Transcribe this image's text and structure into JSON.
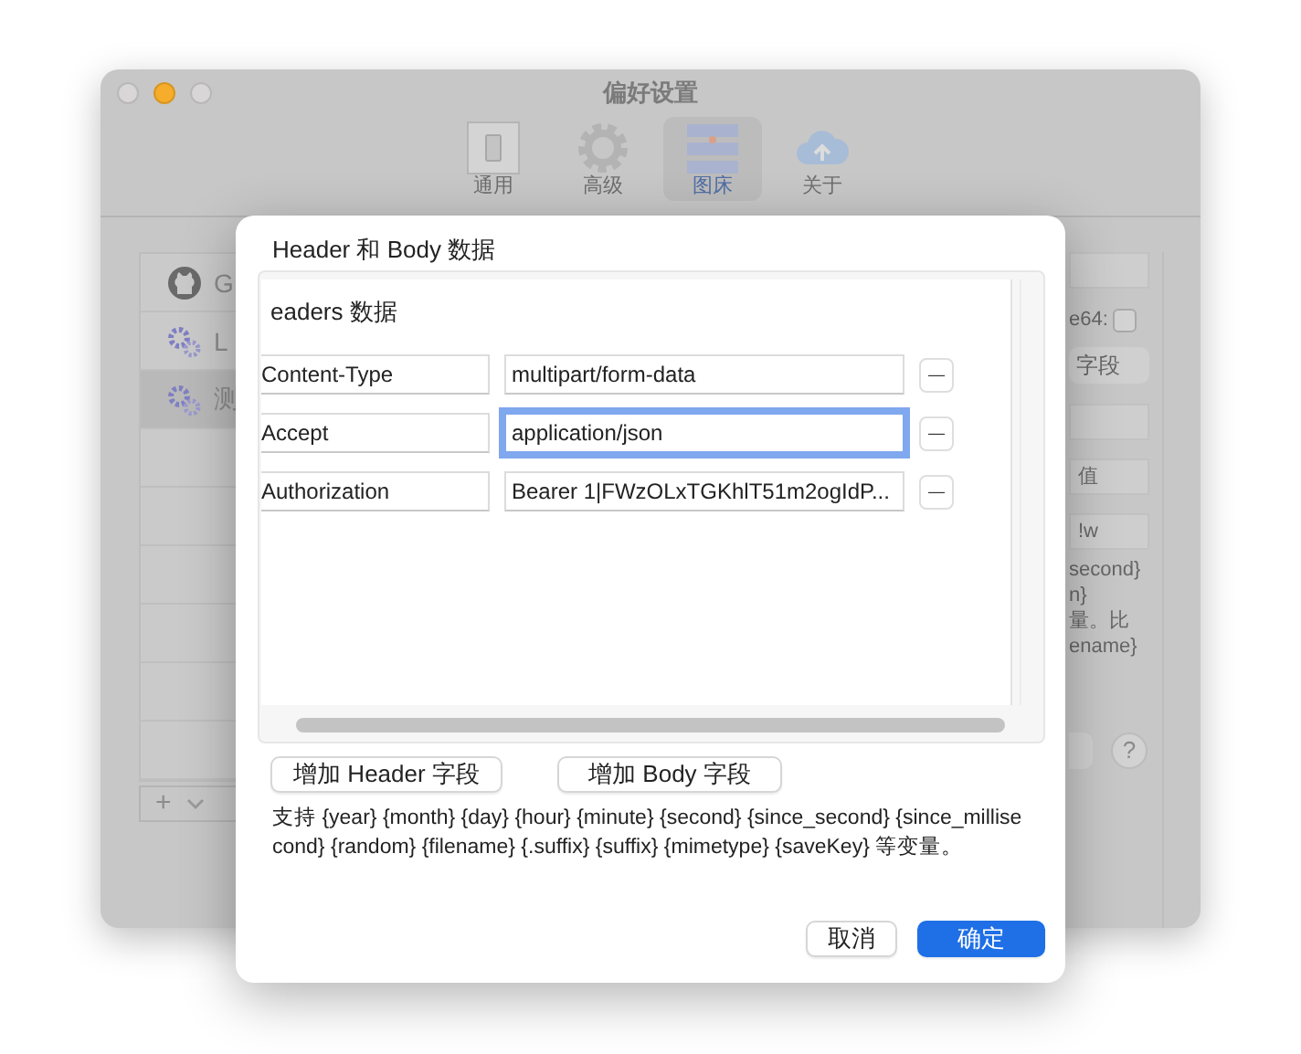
{
  "window": {
    "title": "偏好设置"
  },
  "toolbar": [
    {
      "label": "通用",
      "kind": "general",
      "selected": false
    },
    {
      "label": "高级",
      "kind": "advanced",
      "selected": false
    },
    {
      "label": "图床",
      "kind": "hosting",
      "selected": true
    },
    {
      "label": "关于",
      "kind": "about",
      "selected": false
    }
  ],
  "uploaders": [
    {
      "label": "G",
      "kind": "github",
      "selected": false
    },
    {
      "label": "L",
      "kind": "gears",
      "selected": false
    },
    {
      "label": "测",
      "kind": "gears",
      "selected": true
    }
  ],
  "list_controls": {
    "add": "+"
  },
  "settings_panel": {
    "checkbox_label": "e64:",
    "checked": false,
    "button": "字段",
    "placeholder": "值",
    "field_value": "!w",
    "text_lines": [
      "second}",
      "n}",
      "量。比",
      "ename}"
    ],
    "help": "?"
  },
  "dialog": {
    "title": "Header 和 Body 数据",
    "section": "eaders 数据",
    "headers": [
      {
        "key": "Content-Type",
        "value": "multipart/form-data",
        "focused": false,
        "remove": "—"
      },
      {
        "key": "Accept",
        "value": "application/json",
        "focused": true,
        "remove": "—"
      },
      {
        "key": "Authorization",
        "value": "Bearer 1|FWzOLxTGKhlT51m2ogIdP...",
        "focused": false,
        "remove": "—"
      }
    ],
    "add_buttons": [
      "增加 Header 字段",
      "增加 Body 字段"
    ],
    "note": "支持 {year} {month} {day} {hour} {minute} {second} {since_second} {since_millisecond} {random} {filename} {.suffix} {suffix} {mimetype} {saveKey} 等变量。",
    "buttons": [
      {
        "label": "取消",
        "kind": "cancel"
      },
      {
        "label": "确定",
        "kind": "default"
      }
    ]
  }
}
